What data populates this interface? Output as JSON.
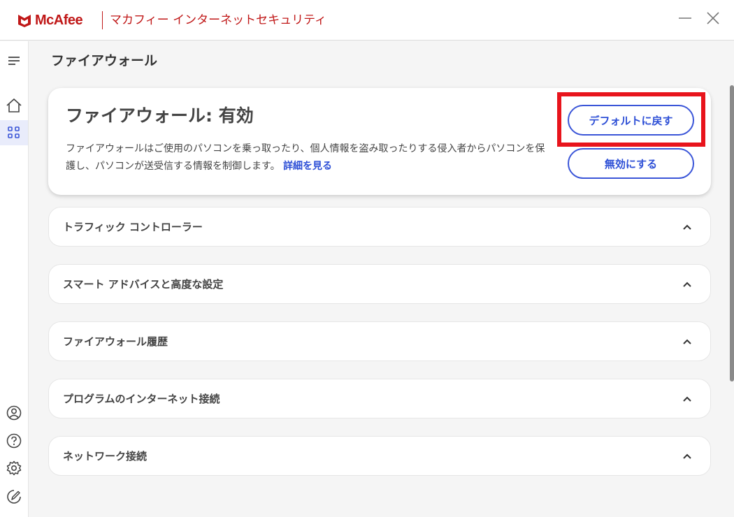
{
  "titlebar": {
    "brand": "McAfee",
    "app_title": "マカフィー インターネットセキュリティ"
  },
  "sidebar": {
    "icons": [
      "menu-icon",
      "home-icon",
      "apps-grid-icon",
      "account-icon",
      "help-icon",
      "settings-icon",
      "feedback-icon"
    ]
  },
  "page": {
    "title": "ファイアウォール"
  },
  "hero": {
    "title": "ファイアウォール: 有効",
    "description": "ファイアウォールはご使用のパソコンを乗っ取ったり、個人情報を盗み取ったりする侵入者からパソコンを保護し、パソコンが送受信する情報を制御します。",
    "link": "詳細を見る",
    "restore_default_label": "デフォルトに戻す",
    "disable_label": "無効にする"
  },
  "sections": [
    {
      "label": "トラフィック コントローラー"
    },
    {
      "label": "スマート アドバイスと高度な設定"
    },
    {
      "label": "ファイアウォール履歴"
    },
    {
      "label": "プログラムのインターネット接続"
    },
    {
      "label": "ネットワーク接続"
    }
  ],
  "colors": {
    "brand_red": "#c01818",
    "accent_blue": "#2d4fd6",
    "highlight_red": "#e8141c"
  }
}
